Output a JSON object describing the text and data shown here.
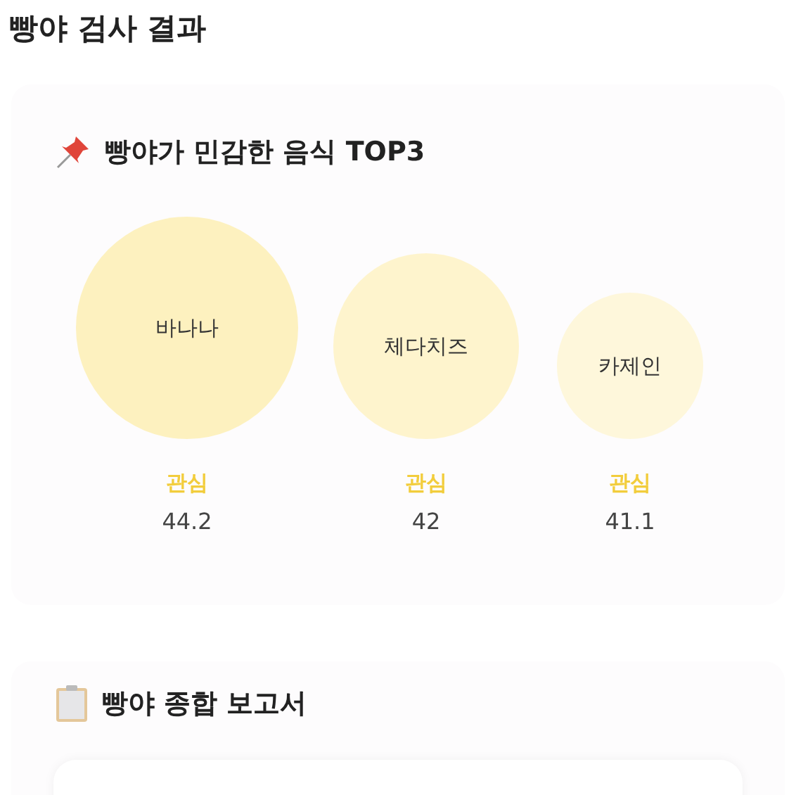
{
  "page_title": "빵야 검사 결과",
  "top_foods": {
    "heading": "빵야가 민감한 음식 TOP3",
    "items": [
      {
        "name": "바나나",
        "tag": "관심",
        "score": "44.2",
        "color": "#fdf1bf"
      },
      {
        "name": "체다치즈",
        "tag": "관심",
        "score": "42",
        "color": "#fef4cd"
      },
      {
        "name": "카제인",
        "tag": "관심",
        "score": "41.1",
        "color": "#fef7db"
      }
    ]
  },
  "report": {
    "heading": "빵야 종합 보고서"
  }
}
